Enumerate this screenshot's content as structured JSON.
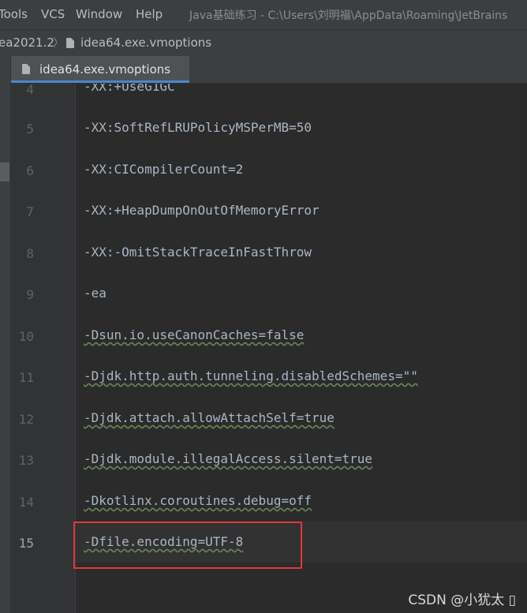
{
  "menu": {
    "items": [
      "Tools",
      "VCS",
      "Window",
      "Help"
    ],
    "window_title": "Java基础练习 - C:\\Users\\刘明福\\AppData\\Roaming\\JetBrains"
  },
  "navbar": {
    "project": "ea2021.2",
    "file": "idea64.exe.vmoptions"
  },
  "tabs": [
    {
      "label": "idea64.exe.vmoptions",
      "active": true
    }
  ],
  "editor": {
    "current_line": 15,
    "lines": [
      {
        "number": "4",
        "text": "-XX:+UseG1GC"
      },
      {
        "number": "5",
        "text": "-XX:SoftRefLRUPolicyMSPerMB=50"
      },
      {
        "number": "6",
        "text": "-XX:CICompilerCount=2"
      },
      {
        "number": "7",
        "text": "-XX:+HeapDumpOnOutOfMemoryError"
      },
      {
        "number": "8",
        "text": "-XX:-OmitStackTraceInFastThrow"
      },
      {
        "number": "9",
        "text": "-ea"
      },
      {
        "number": "10",
        "text": "-Dsun.io.useCanonCaches=false"
      },
      {
        "number": "11",
        "text": "-Djdk.http.auth.tunneling.disabledSchemes=\"\""
      },
      {
        "number": "12",
        "text": "-Djdk.attach.allowAttachSelf=true"
      },
      {
        "number": "13",
        "text": "-Djdk.module.illegalAccess.silent=true"
      },
      {
        "number": "14",
        "text": "-Dkotlinx.coroutines.debug=off"
      },
      {
        "number": "15",
        "text": "-Dfile.encoding=UTF-8"
      }
    ]
  },
  "watermark": "CSDN @小犹太 ▯",
  "colors": {
    "background": "#2b2b2b",
    "gutter": "#313335",
    "chrome": "#3c3f41",
    "tab_underline": "#4a88c7",
    "highlight_box": "#e8353a",
    "code_text": "#a9b7c6"
  }
}
